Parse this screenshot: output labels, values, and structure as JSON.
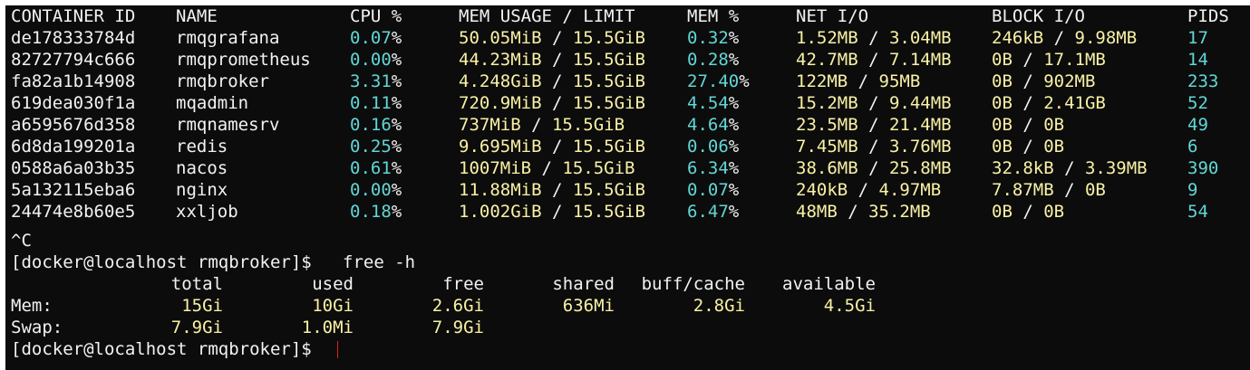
{
  "colors": {
    "background": "#0c0c0c",
    "foreground": "#f2f2f2",
    "yellow": "#f9f1a5",
    "cyan": "#61d6d6",
    "cursor": "#e02020"
  },
  "docker_stats": {
    "headers": [
      "CONTAINER ID",
      "NAME",
      "CPU %",
      "MEM USAGE / LIMIT",
      "MEM %",
      "NET I/O",
      "BLOCK I/O",
      "PIDS"
    ],
    "rows": [
      {
        "id": "de178333784d",
        "name": "rmqgrafana",
        "cpu": "0.07",
        "mem_used": "50.05MiB",
        "mem_limit": "15.5GiB",
        "mem_pct": "0.32",
        "net_in": "1.52MB",
        "net_out": "3.04MB",
        "blk_in": "246kB",
        "blk_out": "9.98MB",
        "pids": "17"
      },
      {
        "id": "82727794c666",
        "name": "rmqprometheus",
        "cpu": "0.00",
        "mem_used": "44.23MiB",
        "mem_limit": "15.5GiB",
        "mem_pct": "0.28",
        "net_in": "42.7MB",
        "net_out": "7.14MB",
        "blk_in": "0B",
        "blk_out": "17.1MB",
        "pids": "14"
      },
      {
        "id": "fa82a1b14908",
        "name": "rmqbroker",
        "cpu": "3.31",
        "mem_used": "4.248GiB",
        "mem_limit": "15.5GiB",
        "mem_pct": "27.40",
        "net_in": "122MB",
        "net_out": "95MB",
        "blk_in": "0B",
        "blk_out": "902MB",
        "pids": "233"
      },
      {
        "id": "619dea030f1a",
        "name": "mqadmin",
        "cpu": "0.11",
        "mem_used": "720.9MiB",
        "mem_limit": "15.5GiB",
        "mem_pct": "4.54",
        "net_in": "15.2MB",
        "net_out": "9.44MB",
        "blk_in": "0B",
        "blk_out": "2.41GB",
        "pids": "52"
      },
      {
        "id": "a6595676d358",
        "name": "rmqnamesrv",
        "cpu": "0.16",
        "mem_used": "737MiB",
        "mem_limit": "15.5GiB",
        "mem_pct": "4.64",
        "net_in": "23.5MB",
        "net_out": "21.4MB",
        "blk_in": "0B",
        "blk_out": "0B",
        "pids": "49"
      },
      {
        "id": "6d8da199201a",
        "name": "redis",
        "cpu": "0.25",
        "mem_used": "9.695MiB",
        "mem_limit": "15.5GiB",
        "mem_pct": "0.06",
        "net_in": "7.45MB",
        "net_out": "3.76MB",
        "blk_in": "0B",
        "blk_out": "0B",
        "pids": "6"
      },
      {
        "id": "0588a6a03b35",
        "name": "nacos",
        "cpu": "0.61",
        "mem_used": "1007MiB",
        "mem_limit": "15.5GiB",
        "mem_pct": "6.34",
        "net_in": "38.6MB",
        "net_out": "25.8MB",
        "blk_in": "32.8kB",
        "blk_out": "3.39MB",
        "pids": "390"
      },
      {
        "id": "5a132115eba6",
        "name": "nginx",
        "cpu": "0.00",
        "mem_used": "11.88MiB",
        "mem_limit": "15.5GiB",
        "mem_pct": "0.07",
        "net_in": "240kB",
        "net_out": "4.97MB",
        "blk_in": "7.87MB",
        "blk_out": "0B",
        "pids": "9"
      },
      {
        "id": "24474e8b60e5",
        "name": "xxljob",
        "cpu": "0.18",
        "mem_used": "1.002GiB",
        "mem_limit": "15.5GiB",
        "mem_pct": "6.47",
        "net_in": "48MB",
        "net_out": "35.2MB",
        "blk_in": "0B",
        "blk_out": "0B",
        "pids": "54"
      }
    ]
  },
  "interrupt": "^C",
  "prompt": "[docker@localhost rmqbroker]$",
  "command": "free -h",
  "free": {
    "headers": [
      "total",
      "used",
      "free",
      "shared",
      "buff/cache",
      "available"
    ],
    "rows": [
      {
        "label": "Mem:",
        "values": [
          "15Gi",
          "10Gi",
          "2.6Gi",
          "636Mi",
          "2.8Gi",
          "4.5Gi"
        ]
      },
      {
        "label": "Swap:",
        "values": [
          "7.9Gi",
          "1.0Mi",
          "7.9Gi",
          "",
          "",
          ""
        ]
      }
    ]
  }
}
